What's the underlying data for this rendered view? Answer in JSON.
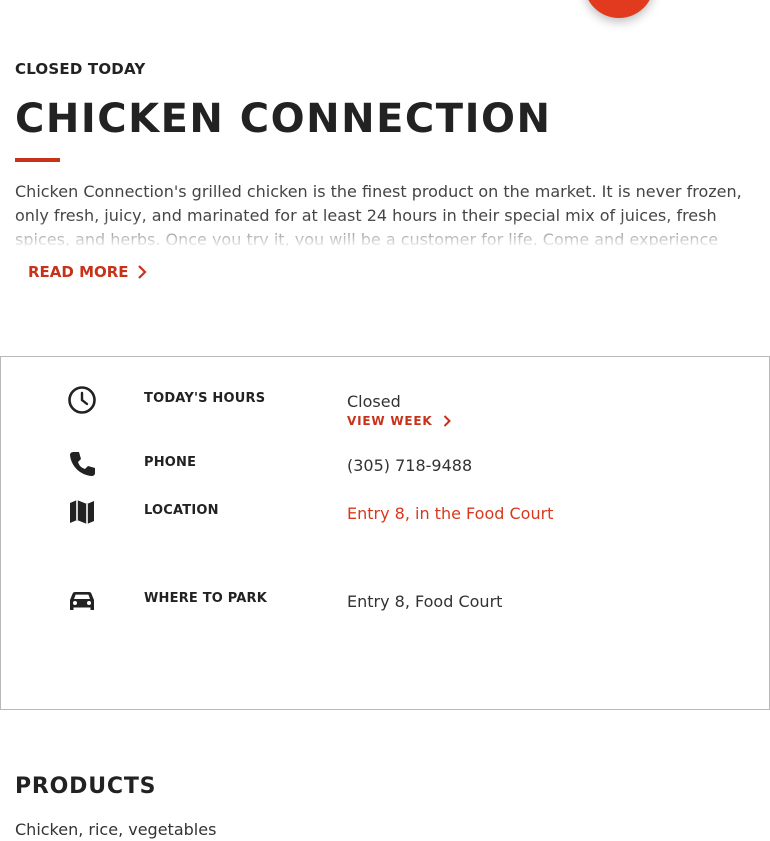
{
  "restaurant": {
    "status": "CLOSED TODAY",
    "name": "CHICKEN CONNECTION",
    "description": "Chicken Connection's grilled chicken is the finest product on the market. It is never frozen, only fresh, juicy, and marinated for at least 24 hours in their special mix of juices, fresh spices, and herbs. Once you try it, you will be a customer for life. Come and experience the quality food.",
    "read_more_label": "READ MORE"
  },
  "info": {
    "hours": {
      "label": "TODAY'S HOURS",
      "value": "Closed",
      "view_week_label": "VIEW WEEK",
      "icon": "clock-icon"
    },
    "phone": {
      "label": "PHONE",
      "value": "(305) 718-9488",
      "icon": "phone-icon"
    },
    "location": {
      "label": "LOCATION",
      "value": "Entry 8, in the Food Court",
      "icon": "map-icon"
    },
    "parking": {
      "label": "WHERE TO PARK",
      "value": "Entry 8, Food Court",
      "icon": "car-icon"
    }
  },
  "products": {
    "title": "PRODUCTS",
    "text": "Chicken, rice, vegetables"
  },
  "colors": {
    "accent": "#c8321b",
    "fab": "#e23a1f",
    "text": "#222222",
    "border": "#b9b9b9"
  }
}
